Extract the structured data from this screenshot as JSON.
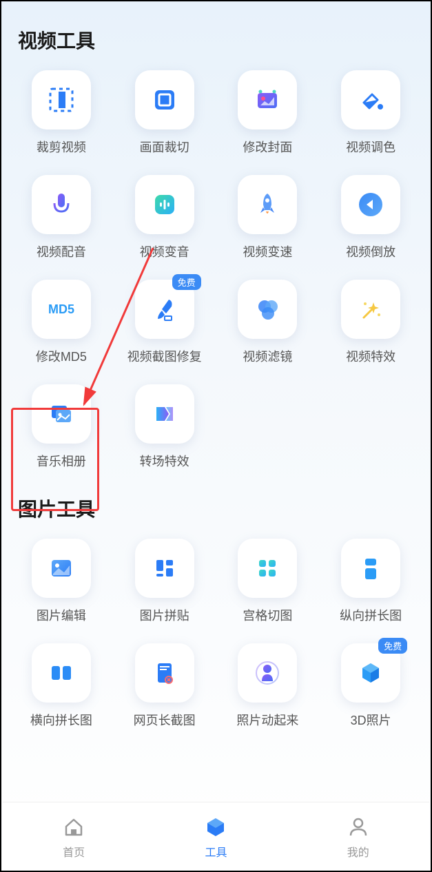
{
  "sections": {
    "video": {
      "title": "视频工具",
      "tools": [
        {
          "label": "裁剪视频",
          "icon": "crop-video"
        },
        {
          "label": "画面裁切",
          "icon": "crop-frame"
        },
        {
          "label": "修改封面",
          "icon": "edit-cover"
        },
        {
          "label": "视频调色",
          "icon": "color-fill"
        },
        {
          "label": "视频配音",
          "icon": "microphone"
        },
        {
          "label": "视频变音",
          "icon": "sound-wave"
        },
        {
          "label": "视频变速",
          "icon": "rocket"
        },
        {
          "label": "视频倒放",
          "icon": "rewind"
        },
        {
          "label": "修改MD5",
          "icon": "md5"
        },
        {
          "label": "视频截图修复",
          "icon": "brush",
          "badge": "免费"
        },
        {
          "label": "视频滤镜",
          "icon": "filter-circles"
        },
        {
          "label": "视频特效",
          "icon": "magic-wand"
        },
        {
          "label": "音乐相册",
          "icon": "music-album",
          "highlighted": true
        },
        {
          "label": "转场特效",
          "icon": "transition"
        }
      ]
    },
    "image": {
      "title": "图片工具",
      "tools": [
        {
          "label": "图片编辑",
          "icon": "image-edit"
        },
        {
          "label": "图片拼贴",
          "icon": "collage"
        },
        {
          "label": "宫格切图",
          "icon": "grid-cut"
        },
        {
          "label": "纵向拼长图",
          "icon": "vertical-stitch"
        },
        {
          "label": "横向拼长图",
          "icon": "horizontal-stitch"
        },
        {
          "label": "网页长截图",
          "icon": "webpage-capture"
        },
        {
          "label": "照片动起来",
          "icon": "photo-animate"
        },
        {
          "label": "3D照片",
          "icon": "3d-cube",
          "badge": "免费"
        }
      ]
    }
  },
  "nav": {
    "items": [
      {
        "label": "首页",
        "icon": "home",
        "active": false
      },
      {
        "label": "工具",
        "icon": "tools",
        "active": true
      },
      {
        "label": "我的",
        "icon": "profile",
        "active": false
      }
    ]
  },
  "badge_text": "免费"
}
